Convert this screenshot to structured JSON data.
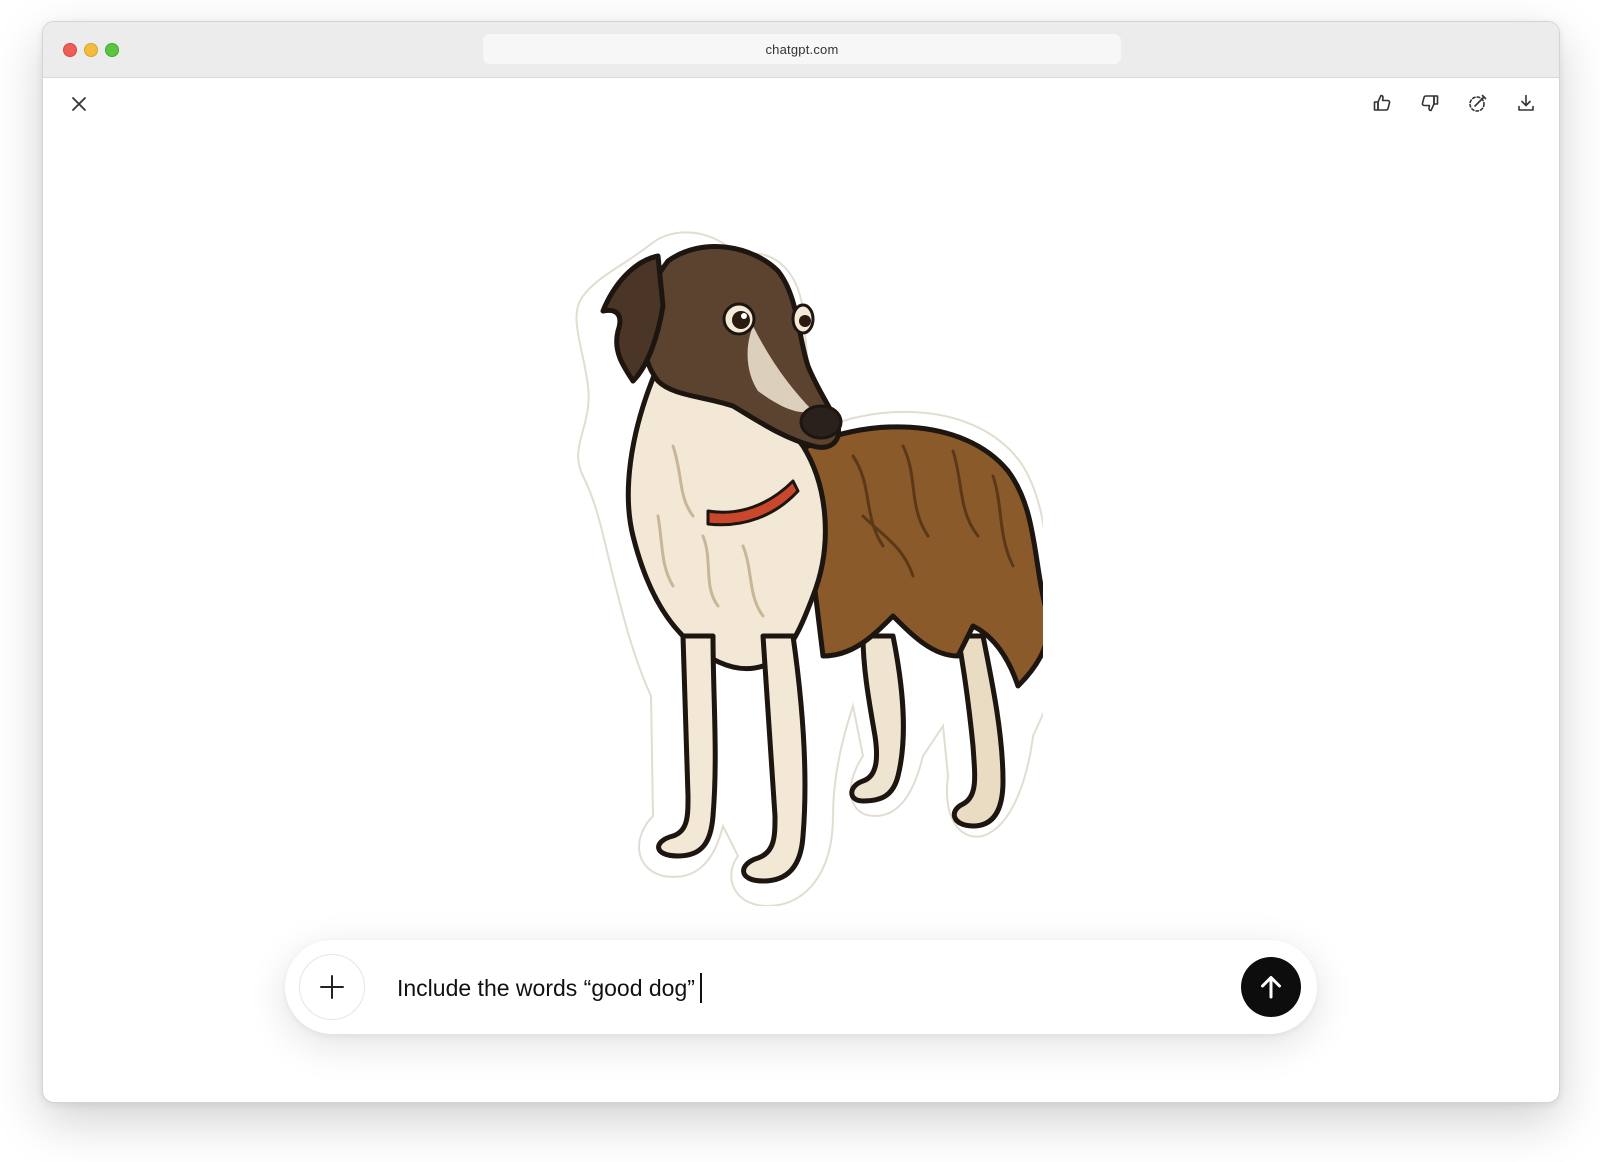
{
  "browser": {
    "url": "chatgpt.com",
    "traffic_lights": [
      "close",
      "minimize",
      "zoom"
    ]
  },
  "viewer": {
    "close_icon": "close-icon",
    "toolbar": [
      {
        "name": "thumbs-up-icon"
      },
      {
        "name": "thumbs-down-icon"
      },
      {
        "name": "edit-selection-icon"
      },
      {
        "name": "download-icon"
      }
    ],
    "image": {
      "subject": "sticker illustration of a borzoi dog",
      "colors": {
        "fur_brown": "#8b5a2b",
        "fur_cream": "#f2e8d5",
        "collar": "#c9472a",
        "outline": "#1c1510"
      }
    }
  },
  "composer": {
    "plus_icon": "plus-icon",
    "input_value": "Include the words “good dog”",
    "send_icon": "arrow-up-icon",
    "send_color": "#0d0d0d"
  }
}
